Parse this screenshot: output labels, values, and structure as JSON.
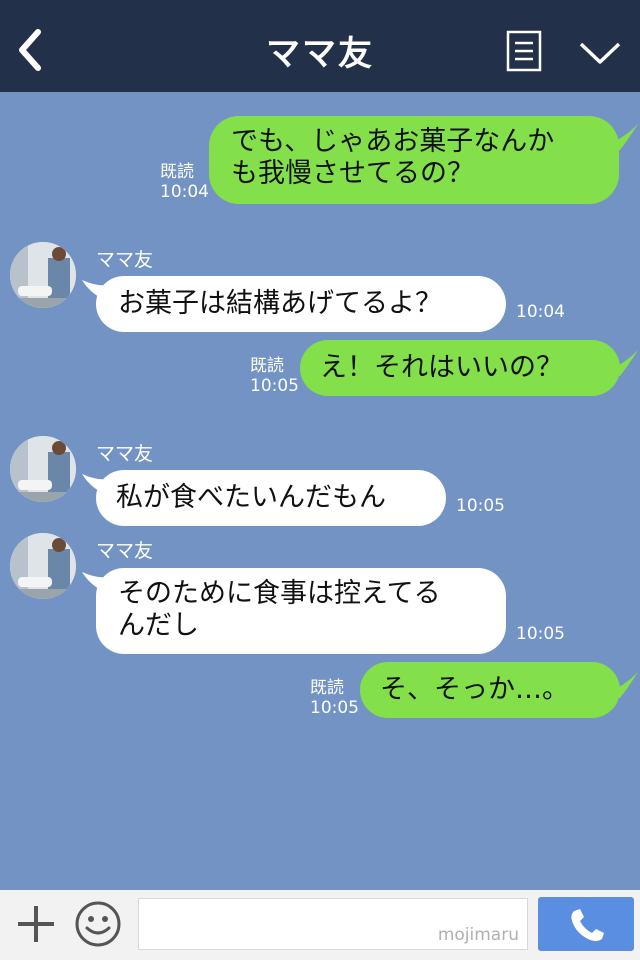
{
  "header": {
    "title": "ママ友",
    "back_icon": "chevron-left-icon",
    "notes_icon": "notes-icon",
    "menu_icon": "chevron-down-icon"
  },
  "messages": [
    {
      "side": "me",
      "text_lines": [
        "でも、じゃあお菓子なんか",
        "も我慢させてるの？"
      ],
      "read": "既読",
      "time": "10:04"
    },
    {
      "side": "them",
      "sender": "ママ友",
      "text_lines": [
        "お菓子は結構あげてるよ？"
      ],
      "time": "10:04"
    },
    {
      "side": "me",
      "text_lines": [
        "え！それはいいの？"
      ],
      "read": "既読",
      "time": "10:05"
    },
    {
      "side": "them",
      "sender": "ママ友",
      "text_lines": [
        "私が食べたいんだもん"
      ],
      "time": "10:05"
    },
    {
      "side": "them",
      "sender": "ママ友",
      "text_lines": [
        "そのために食事は控えてる",
        "んだし"
      ],
      "time": "10:05"
    },
    {
      "side": "me",
      "text_lines": [
        "そ、そっか…。"
      ],
      "read": "既読",
      "time": "10:05"
    }
  ],
  "footer": {
    "watermark": "mojimaru",
    "plus_icon": "plus-icon",
    "emoji_icon": "smiley-icon",
    "call_icon": "phone-icon"
  },
  "colors": {
    "header_bg": "#23304a",
    "chat_bg": "#7393c4",
    "me_bubble": "#84e04a",
    "them_bubble": "#ffffff",
    "call_button": "#5a8ee0"
  }
}
